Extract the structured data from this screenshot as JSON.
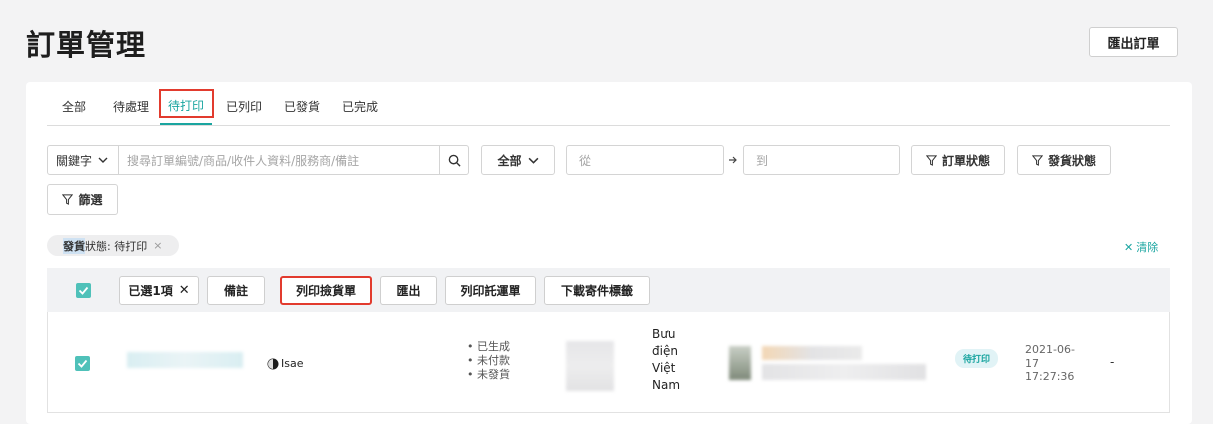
{
  "header": {
    "title": "訂單管理",
    "export_label": "匯出訂單"
  },
  "tabs": [
    {
      "label": "全部"
    },
    {
      "label": "待處理"
    },
    {
      "label": "待打印"
    },
    {
      "label": "已列印"
    },
    {
      "label": "已發貨"
    },
    {
      "label": "已完成"
    }
  ],
  "active_tab": "待打印",
  "filters": {
    "keyword_label": "關鍵字",
    "search_placeholder": "搜尋訂單編號/商品/收件人資料/服務商/備註",
    "range_select": "全部",
    "from_placeholder": "從",
    "to_placeholder": "到",
    "order_status": "訂單狀態",
    "shipping_status": "發貨狀態",
    "filter": "篩選"
  },
  "active_filter": {
    "key": "發貨",
    "key_rest": "狀態",
    "value": ": 待打印",
    "close": "×"
  },
  "clear_label": "清除",
  "toolbar": {
    "selected": "已選1項",
    "note": "備註",
    "print_picking": "列印撿貨單",
    "export": "匯出",
    "print_waybill": "列印託運單",
    "download_label": "下載寄件標籤"
  },
  "order": {
    "brand": "Isae",
    "statuses": [
      "已生成",
      "未付款",
      "未發貨"
    ],
    "carrier_lines": [
      "Bưu",
      "điện",
      "Việt",
      "Nam"
    ],
    "badge": "待打印",
    "date_lines": [
      "2021-06-",
      "17",
      "17:27:36"
    ],
    "extra": "-"
  },
  "colors": {
    "accent": "#1aa5a0",
    "highlight": "#e23b2e",
    "checkbox": "#4fc1b9"
  }
}
